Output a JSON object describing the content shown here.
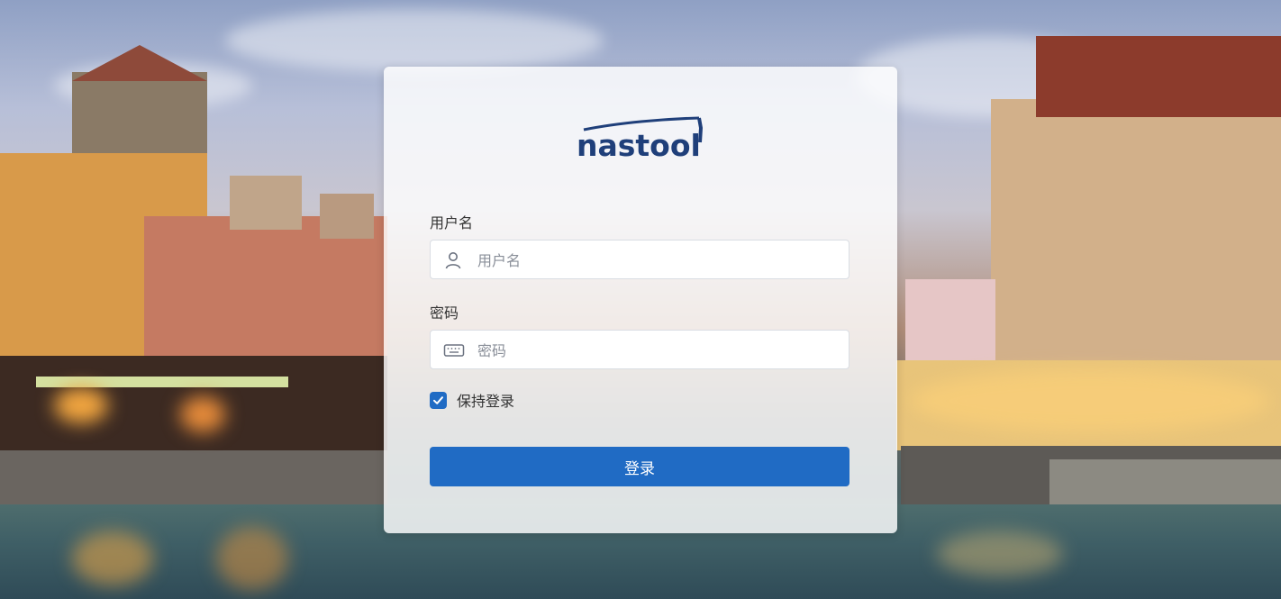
{
  "app": {
    "logo_text": "nastool"
  },
  "login": {
    "username_label": "用户名",
    "username_placeholder": "用户名",
    "username_value": "",
    "password_label": "密码",
    "password_placeholder": "密码",
    "password_value": "",
    "remember_label": "保持登录",
    "remember_checked": true,
    "submit_label": "登录"
  },
  "icons": {
    "username": "user-icon",
    "password": "keyboard-icon",
    "remember": "check-icon"
  },
  "colors": {
    "primary": "#206bc4",
    "logo": "#1f3f7a",
    "card_bg": "rgba(255,255,255,0.82)"
  }
}
